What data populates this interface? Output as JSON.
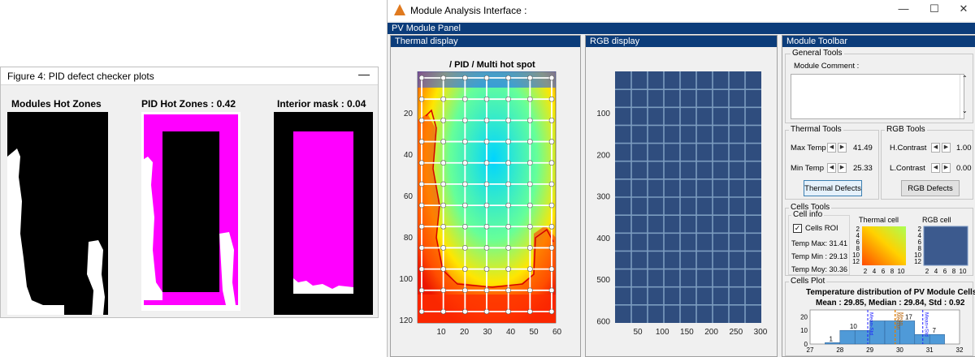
{
  "figure4": {
    "title": "Figure 4:  PID defect checker plots",
    "minimize": "—",
    "plots": [
      {
        "title": "Modules Hot Zones"
      },
      {
        "title": "PID Hot Zones : 0.42"
      },
      {
        "title": "Interior mask : 0.04"
      }
    ]
  },
  "main_window": {
    "title": "Module Analysis Interface :",
    "controls": {
      "minimize": "—",
      "maximize": "☐",
      "close": "✕"
    },
    "panel_title": "PV Module Panel",
    "thermal": {
      "panel_label": "Thermal display",
      "plot_title": "/ PID / Multi hot spot",
      "y_ticks": [
        "20",
        "40",
        "60",
        "80",
        "100",
        "120"
      ],
      "x_ticks": [
        "10",
        "20",
        "30",
        "40",
        "50",
        "60"
      ]
    },
    "rgb": {
      "panel_label": "RGB display",
      "y_ticks": [
        "100",
        "200",
        "300",
        "400",
        "500",
        "600"
      ],
      "x_ticks": [
        "50",
        "100",
        "150",
        "200",
        "250",
        "300"
      ]
    },
    "toolbar": {
      "panel_label": "Module Toolbar",
      "general_tools": {
        "title": "General Tools",
        "comment_label": "Module Comment :",
        "comment_value": ""
      },
      "thermal_tools": {
        "title": "Thermal Tools",
        "max_temp_label": "Max Temp",
        "max_temp_value": "41.49",
        "min_temp_label": "Min Temp",
        "min_temp_value": "25.33",
        "defects_button": "Thermal Defects"
      },
      "rgb_tools": {
        "title": "RGB Tools",
        "h_contrast_label": "H.Contrast",
        "h_contrast_value": "1.00",
        "l_contrast_label": "L.Contrast",
        "l_contrast_value": "0.00",
        "defects_button": "RGB Defects"
      },
      "cells_tools": {
        "title": "Cells Tools",
        "cell_info_title": "Cell info",
        "cells_roi_label": "Cells ROI",
        "cells_roi_checked": true,
        "temp_max": "Temp Max:  31.41",
        "temp_min": "Temp Min :  29.13",
        "temp_moy": "Temp Moy:  30.36",
        "thermal_cell_title": "Thermal cell",
        "rgb_cell_title": "RGB cell",
        "cell_ticks": [
          "2",
          "4",
          "6",
          "8",
          "10",
          "12"
        ],
        "cell_x_ticks": [
          "2",
          "4",
          "6",
          "8",
          "10"
        ]
      },
      "cells_plot": {
        "title": "Cells Plot",
        "chart_title": "Temperature distribution of PV Module Cells",
        "stats": "Mean : 29.85, Median : 29.84, Std : 0.92",
        "y_ticks": [
          "0",
          "10",
          "20"
        ],
        "x_ticks": [
          "27",
          "28",
          "29",
          "30",
          "31",
          "32"
        ],
        "bar_labels": [
          "1",
          "10",
          "17",
          "7"
        ],
        "line_labels": [
          "Mean-Std",
          "Median",
          "Mean",
          "Mean+Std"
        ]
      }
    }
  },
  "colors": {
    "panel_bar": "#0b3c7a",
    "magenta": "#ff00ff",
    "rgb_blue": "#2f4d7e"
  }
}
